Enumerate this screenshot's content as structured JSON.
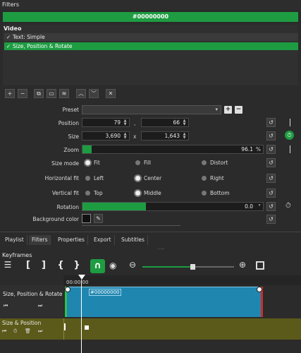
{
  "panel": {
    "title": "Filters"
  },
  "clip": {
    "name": "#00000000"
  },
  "filters": {
    "section": "Video",
    "items": [
      {
        "check": "✓",
        "label": "Text: Simple"
      },
      {
        "check": "✓",
        "label": "Size, Position & Rotate"
      }
    ]
  },
  "toolbar": {
    "add": "+",
    "remove": "−",
    "copy": "⧉",
    "paste": "▭",
    "stack": "≋",
    "up": "︿",
    "down": "﹀",
    "close": "✕"
  },
  "preset": {
    "label": "Preset",
    "value": "",
    "add": "+",
    "remove": "−"
  },
  "position": {
    "label": "Position",
    "x": "79",
    "sep": ",",
    "y": "66"
  },
  "size": {
    "label": "Size",
    "w": "3,690",
    "sep": "x",
    "h": "1,643"
  },
  "zoom": {
    "label": "Zoom",
    "value": "96.1",
    "unit": "%",
    "level": 0.05
  },
  "size_mode": {
    "label": "Size mode",
    "options": [
      "Fit",
      "Fill",
      "Distort"
    ],
    "selected": "Fit"
  },
  "hfit": {
    "label": "Horizontal fit",
    "options": [
      "Left",
      "Center",
      "Right"
    ],
    "selected": "Center"
  },
  "vfit": {
    "label": "Vertical fit",
    "options": [
      "Top",
      "Middle",
      "Bottom"
    ],
    "selected": "Middle"
  },
  "rotation": {
    "label": "Rotation",
    "value": "0.0",
    "unit": "°",
    "level": 0.35
  },
  "bgcolor": {
    "label": "Background color"
  },
  "tabs": [
    "Playlist",
    "Filters",
    "Properties",
    "Export",
    "Subtitles"
  ],
  "active_tab": "Filters",
  "keyframes": {
    "title": "Keyframes",
    "time": "00:00:00",
    "tracks": [
      {
        "name": "Size, Position & Rotate",
        "clip": "#00000000"
      },
      {
        "name": "Size & Position"
      }
    ]
  },
  "colors": {
    "accent": "#1e9c42",
    "clip": "#1f86b0",
    "track2": "#5c5a1a"
  }
}
